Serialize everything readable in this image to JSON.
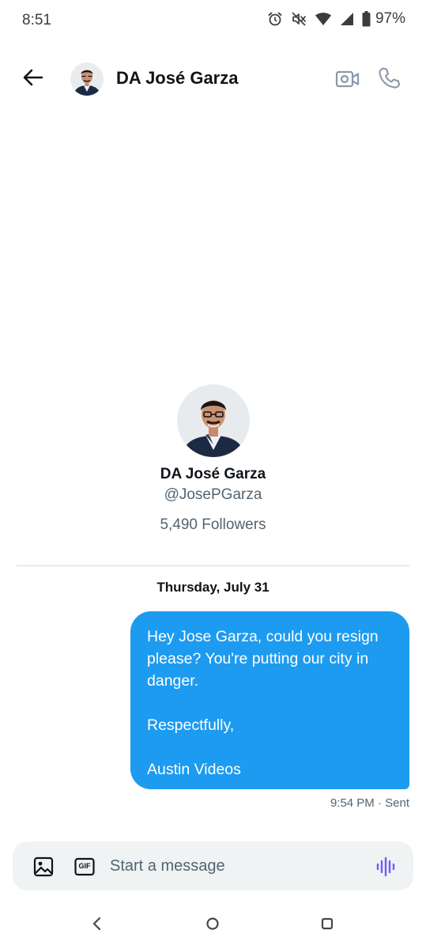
{
  "status_bar": {
    "time": "8:51",
    "battery_percent": "97%",
    "icons": [
      "alarm-icon",
      "mute-icon",
      "wifi-icon",
      "signal-icon",
      "battery-icon"
    ]
  },
  "header": {
    "title": "DA José Garza",
    "back_icon": "arrow-left-icon",
    "video_icon": "video-call-icon",
    "call_icon": "phone-icon"
  },
  "profile": {
    "name": "DA José Garza",
    "handle": "@JosePGarza",
    "followers": "5,490 Followers"
  },
  "conversation": {
    "date": "Thursday, July 31",
    "messages": [
      {
        "line1": "Hey Jose Garza, could you resign",
        "line2": "please? You're putting our city in",
        "line3": "danger.",
        "line4": "Respectfully,",
        "line5": "Austin Videos",
        "time_status": "9:54 PM · Sent"
      }
    ]
  },
  "composer": {
    "placeholder": "Start a message",
    "value": "",
    "media_icon": "image-icon",
    "gif_label": "GIF",
    "voice_icon": "voice-waveform-icon"
  },
  "colors": {
    "accent": "#1d9bf0",
    "voice": "#7856ff",
    "muted_text": "#536471",
    "composer_bg": "#eff3f4"
  }
}
